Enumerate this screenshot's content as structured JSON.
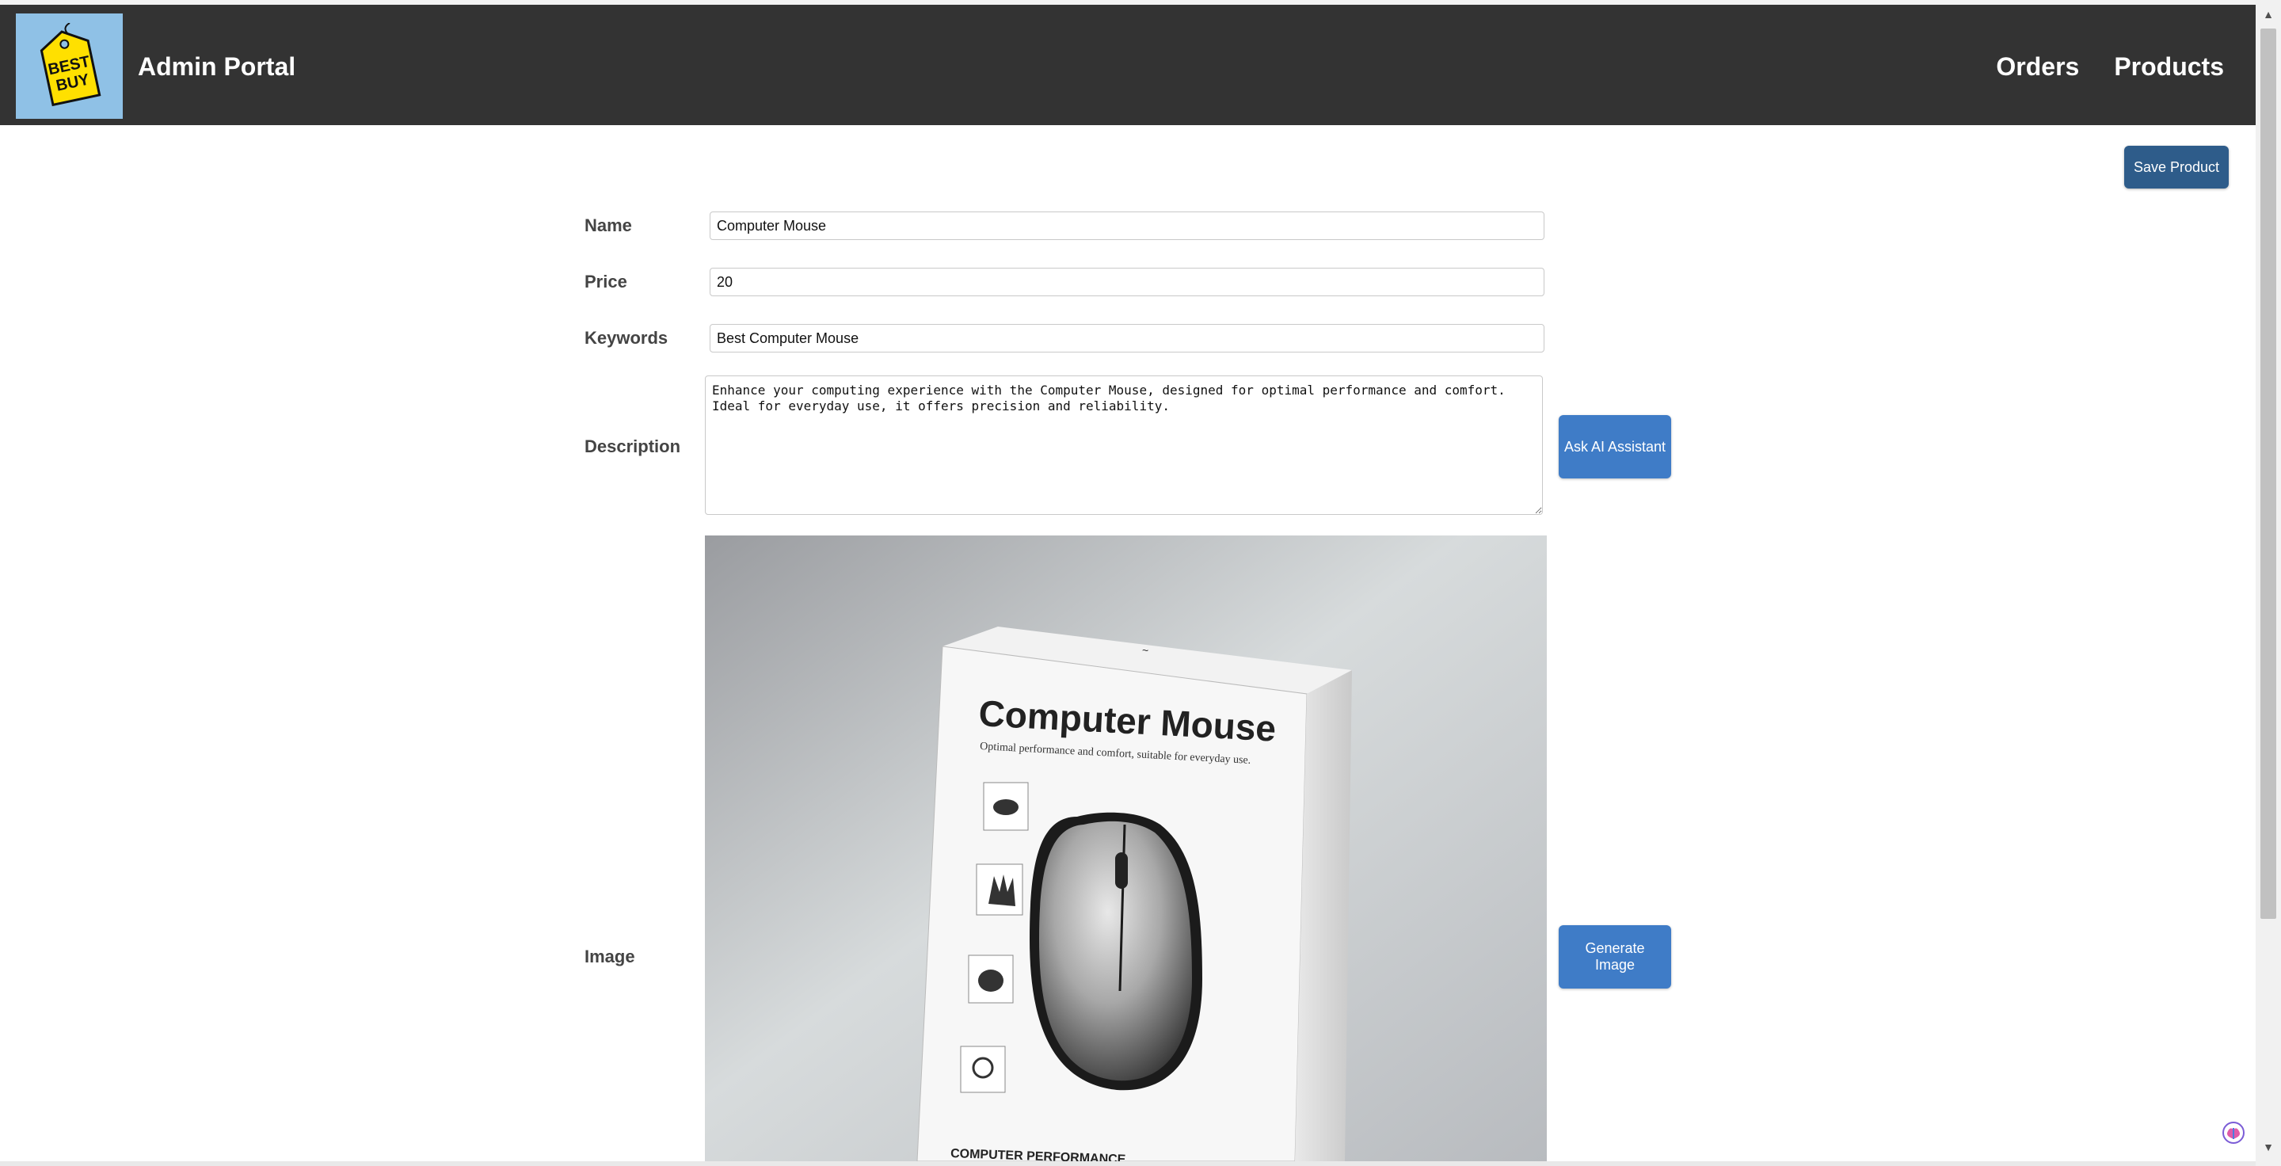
{
  "header": {
    "logo_text": [
      "BEST",
      "BUY"
    ],
    "title": "Admin Portal",
    "nav": [
      {
        "label": "Orders"
      },
      {
        "label": "Products"
      }
    ]
  },
  "toolbar": {
    "save_label": "Save Product"
  },
  "form": {
    "name": {
      "label": "Name",
      "value": "Computer Mouse"
    },
    "price": {
      "label": "Price",
      "value": "20"
    },
    "keywords": {
      "label": "Keywords",
      "value": "Best Computer Mouse"
    },
    "description": {
      "label": "Description",
      "value": "Enhance your computing experience with the Computer Mouse, designed for optimal performance and comfort.\nIdeal for everyday use, it offers precision and reliability.",
      "ai_button_label": "Ask AI Assistant"
    },
    "image": {
      "label": "Image",
      "generate_button_label": "Generate Image",
      "box_title": "Computer Mouse",
      "box_tagline": "Optimal performance and comfort, suitable for everyday use.",
      "box_footer": "COMPUTER PERFORMANCE"
    }
  },
  "colors": {
    "header_bg": "#333333",
    "logo_bg": "#8fc1e6",
    "save_button": "#2e5c8a",
    "action_button": "#3f7cc7"
  },
  "icons": {
    "logo": "best-buy-tag-logo",
    "extension": "brain-extension-icon"
  }
}
